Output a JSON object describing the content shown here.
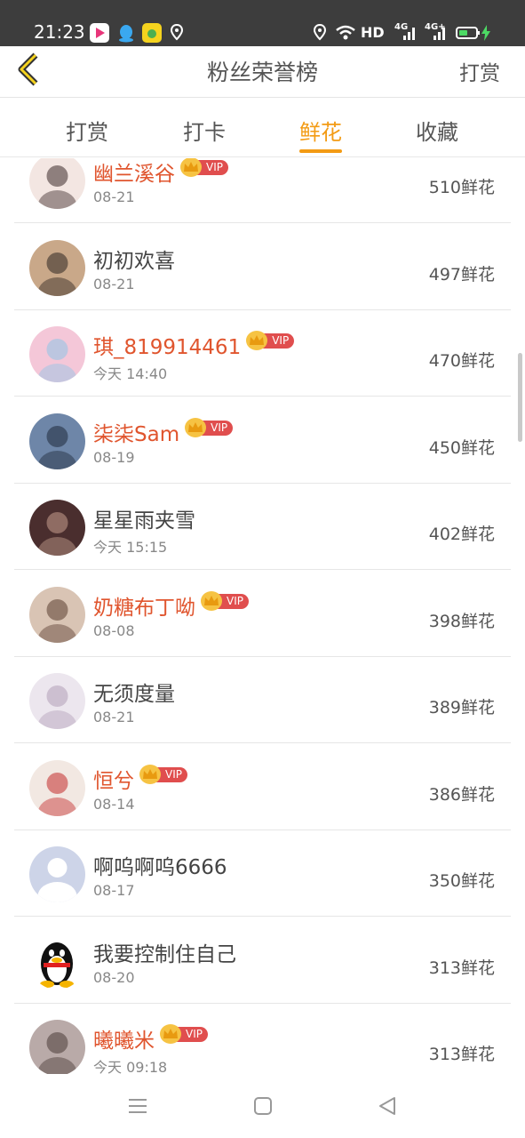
{
  "status_bar": {
    "time": "21:23",
    "network_label": "HD",
    "signal_1": "4G",
    "signal_2": "4G+",
    "icons": [
      "video-app-icon",
      "qq-icon",
      "yellow-app-icon",
      "location-pin-icon",
      "location-icon",
      "wifi-icon",
      "signal-icon",
      "battery-icon",
      "charging-icon"
    ]
  },
  "header": {
    "title": "粉丝荣誉榜",
    "action_label": "打赏",
    "back_icon": "chevron-left-icon"
  },
  "tabs": [
    {
      "label": "打赏",
      "active": false
    },
    {
      "label": "打卡",
      "active": false
    },
    {
      "label": "鲜花",
      "active": true
    },
    {
      "label": "收藏",
      "active": false
    }
  ],
  "colors": {
    "accent": "#f39b14",
    "vip_name": "#e0552e",
    "vip_tag": "#e04e4e",
    "crown": "#f6c343"
  },
  "vip_label": "VIP",
  "fans": [
    {
      "name": "幽兰溪谷",
      "date": "08-21",
      "count": "510鲜花",
      "vip": true
    },
    {
      "name": "初初欢喜",
      "date": "08-21",
      "count": "497鲜花",
      "vip": false
    },
    {
      "name": "琪_819914461",
      "date": "今天 14:40",
      "count": "470鲜花",
      "vip": true
    },
    {
      "name": "柒柒Sam",
      "date": "08-19",
      "count": "450鲜花",
      "vip": true
    },
    {
      "name": "星星雨夹雪",
      "date": "今天 15:15",
      "count": "402鲜花",
      "vip": false
    },
    {
      "name": "奶糖布丁呦",
      "date": "08-08",
      "count": "398鲜花",
      "vip": true
    },
    {
      "name": "无须度量",
      "date": "08-21",
      "count": "389鲜花",
      "vip": false
    },
    {
      "name": "恒兮",
      "date": "08-14",
      "count": "386鲜花",
      "vip": true
    },
    {
      "name": "啊呜啊呜6666",
      "date": "08-17",
      "count": "350鲜花",
      "vip": false
    },
    {
      "name": "我要控制住自己",
      "date": "08-20",
      "count": "313鲜花",
      "vip": false
    },
    {
      "name": "曦曦米",
      "date": "今天 09:18",
      "count": "313鲜花",
      "vip": true
    }
  ],
  "nav": {
    "icons": [
      "menu-icon",
      "home-square-icon",
      "back-triangle-icon"
    ]
  }
}
